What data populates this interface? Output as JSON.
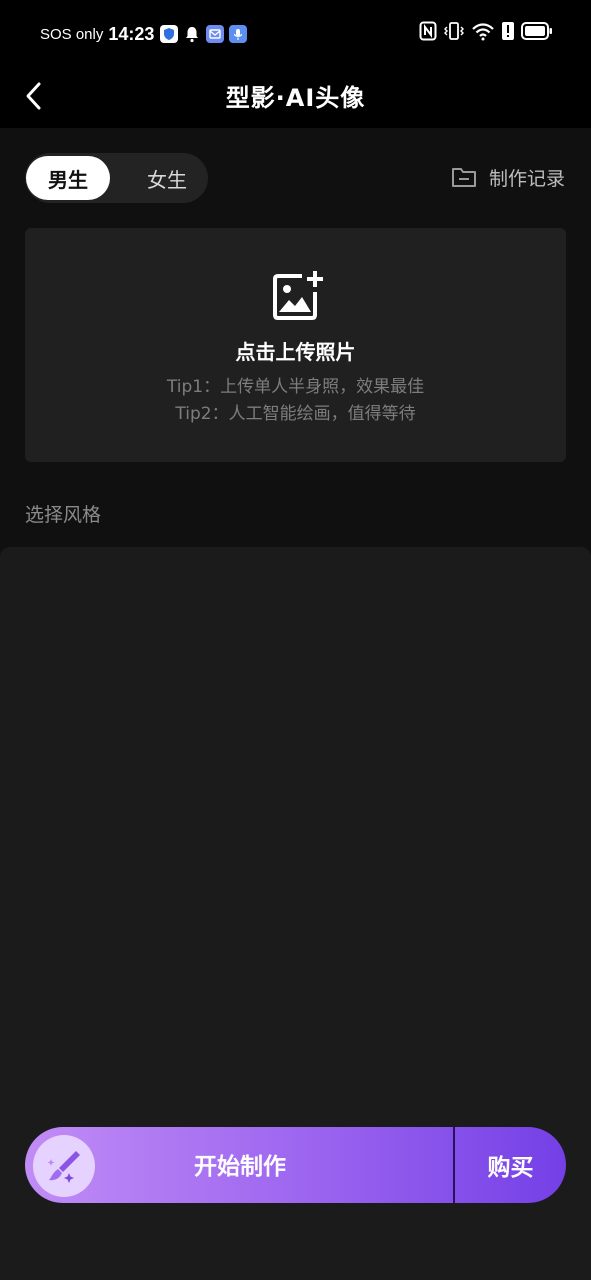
{
  "status_bar": {
    "carrier": "SOS only",
    "time": "14:23",
    "icons": [
      "shield-app-icon",
      "bell-icon",
      "mail-app-icon",
      "mic-app-icon",
      "nfc-icon",
      "vibrate-icon",
      "wifi-icon",
      "alert-icon",
      "battery-icon"
    ]
  },
  "header": {
    "title": "型影·AI头像"
  },
  "gender": {
    "male_label": "男生",
    "female_label": "女生",
    "selected": "男生"
  },
  "history": {
    "label": "制作记录"
  },
  "upload": {
    "title": "点击上传照片",
    "tip1": "Tip1：上传单人半身照，效果最佳",
    "tip2": "Tip2：人工智能绘画，值得等待"
  },
  "style_section": {
    "label": "选择风格"
  },
  "actions": {
    "start_label": "开始制作",
    "buy_label": "购买"
  },
  "colors": {
    "accent_start": "#c18cf6",
    "accent_end": "#7440e6",
    "background": "#101010",
    "card": "#202020"
  }
}
